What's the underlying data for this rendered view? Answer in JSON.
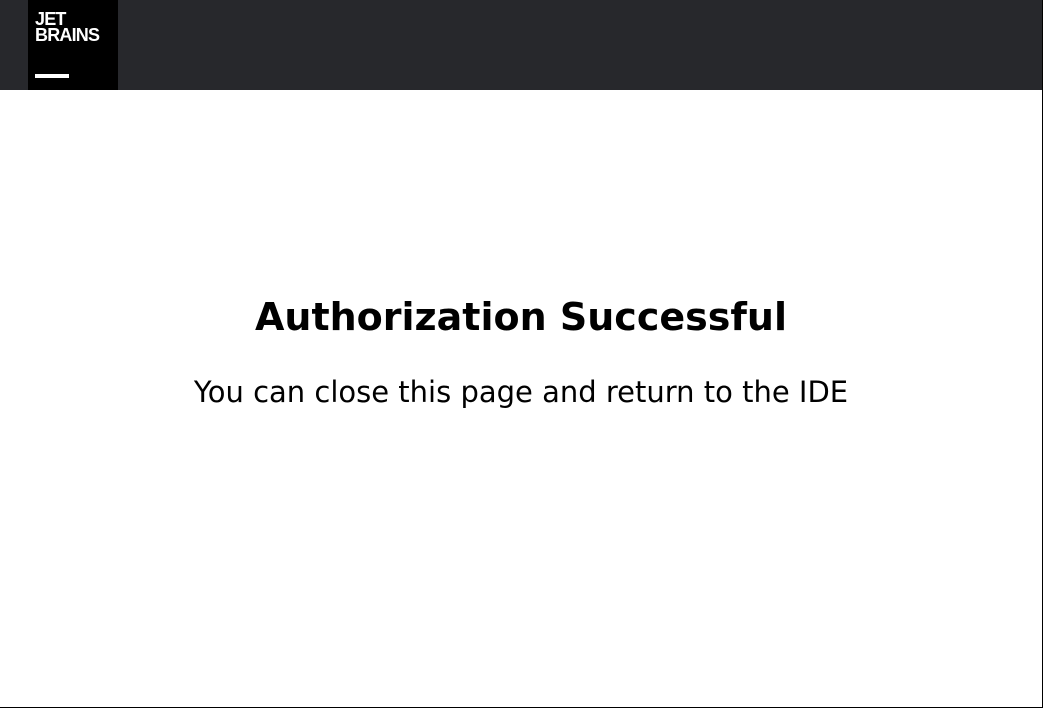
{
  "header": {
    "logo": {
      "line1": "JET",
      "line2": "BRAINS"
    }
  },
  "main": {
    "title": "Authorization Successful",
    "message": "You can close this page and return to the IDE"
  },
  "colors": {
    "header_bg": "#27282c",
    "logo_bg": "#000000",
    "page_bg": "#ffffff",
    "text": "#000000"
  }
}
